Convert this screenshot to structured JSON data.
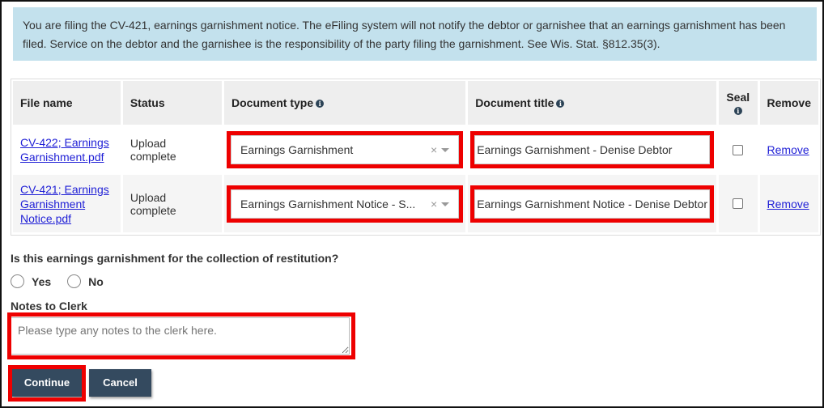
{
  "alert": {
    "text": "You are filing the CV-421, earnings garnishment notice. The eFiling system will not notify the debtor or garnishee that an earnings garnishment has been filed. Service on the debtor and the garnishee is the responsibility of the party filing the garnishment. See Wis. Stat. §812.35(3)."
  },
  "table": {
    "headers": {
      "file_name": "File name",
      "status": "Status",
      "document_type": "Document type",
      "document_title": "Document title",
      "seal": "Seal",
      "remove": "Remove"
    },
    "info_icon_glyph": "i",
    "rows": [
      {
        "file_name": "CV-422; Earnings Garnishment.pdf",
        "status": "Upload complete",
        "document_type": "Earnings Garnishment",
        "document_title": "Earnings Garnishment - Denise Debtor",
        "sealed": false,
        "remove_label": "Remove"
      },
      {
        "file_name": "CV-421; Earnings Garnishment Notice.pdf",
        "status": "Upload complete",
        "document_type": "Earnings Garnishment Notice - S...",
        "document_title": "Earnings Garnishment Notice - Denise Debtor",
        "sealed": false,
        "remove_label": "Remove"
      }
    ],
    "clear_glyph": "×"
  },
  "restitution": {
    "question": "Is this earnings garnishment for the collection of restitution?",
    "options": [
      "Yes",
      "No"
    ]
  },
  "notes": {
    "label": "Notes to Clerk",
    "placeholder": "Please type any notes to the clerk here.",
    "value": ""
  },
  "buttons": {
    "continue": "Continue",
    "cancel": "Cancel"
  },
  "colors": {
    "alert_bg": "#c3e1ed",
    "highlight": "#ee0000",
    "button_bg": "#344a5f",
    "link": "#1f1fd6"
  }
}
